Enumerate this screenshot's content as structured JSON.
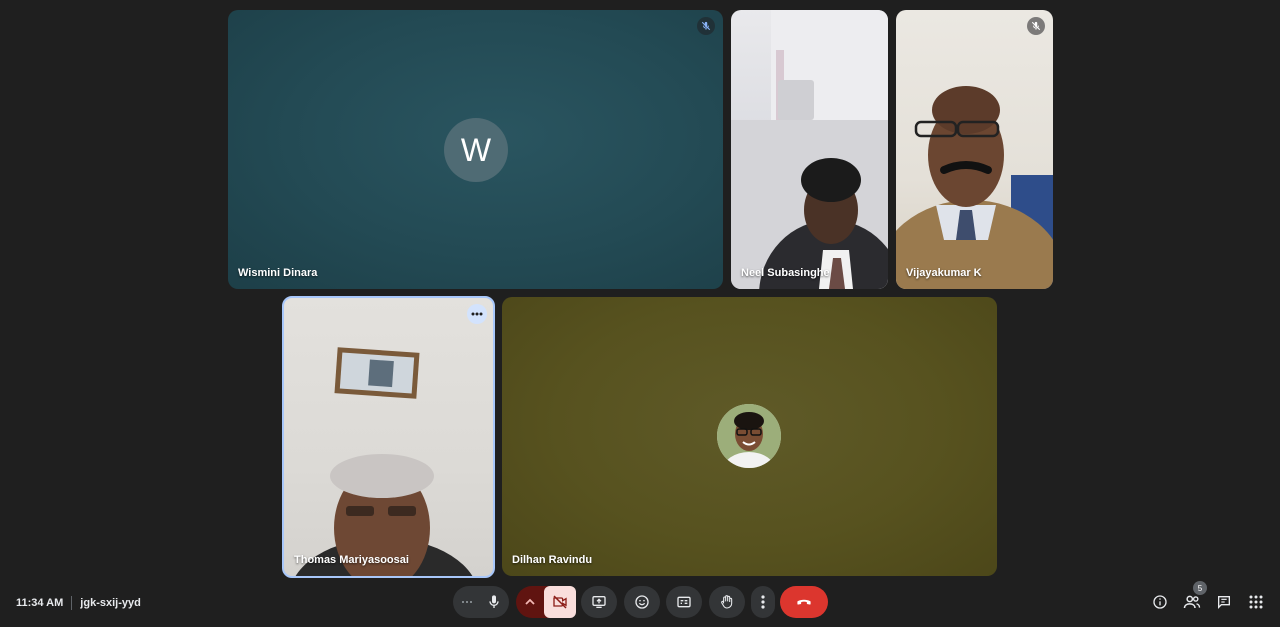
{
  "participants": [
    {
      "name": "Wismini Dinara",
      "initial": "W",
      "muted": true,
      "video": false
    },
    {
      "name": "Neel Subasinghe",
      "muted": false,
      "video": true
    },
    {
      "name": "Vijayakumar K",
      "muted": true,
      "video": true
    },
    {
      "name": "Thomas Mariyasoosai",
      "muted": false,
      "video": true,
      "selected": true
    },
    {
      "name": "Dilhan Ravindu",
      "muted": false,
      "video": false
    }
  ],
  "meeting": {
    "time": "11:34 AM",
    "code": "jgk-sxij-yyd",
    "people_count": "5"
  },
  "controls": [
    "more-options",
    "microphone",
    "camera-options",
    "camera-off",
    "present-screen",
    "reactions",
    "captions",
    "raise-hand",
    "more-actions",
    "leave-call"
  ],
  "side_icons": [
    "meeting-details",
    "people",
    "chat",
    "activities"
  ],
  "colors": {
    "accent_selected": "#a8c7fa",
    "leave": "#dc362e",
    "camera_off_bg": "#f9dedc",
    "camera_off_fg": "#8c1d18"
  }
}
